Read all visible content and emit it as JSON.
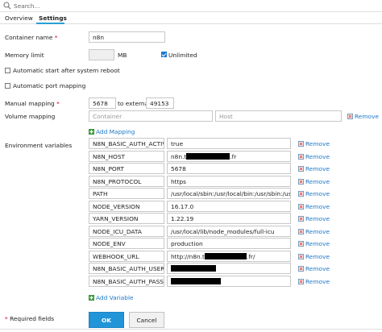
{
  "search": {
    "placeholder": "Search..."
  },
  "tabs": [
    {
      "label": "Overview"
    },
    {
      "label": "Settings"
    }
  ],
  "form": {
    "container_name": {
      "label": "Container name",
      "required_mark": "*",
      "value": "n8n"
    },
    "memory_limit": {
      "label": "Memory limit",
      "value": "",
      "unit": "MB",
      "unlimited_label": "Unlimited",
      "unlimited_checked": true
    },
    "auto_start": {
      "label": "Automatic start after system reboot",
      "checked": false
    },
    "auto_port": {
      "label": "Automatic port mapping",
      "checked": false
    },
    "manual_mapping": {
      "label": "Manual mapping",
      "required_mark": "*",
      "internal": "5678",
      "to_external_label": "to external",
      "external": "49153"
    },
    "volume_mapping": {
      "label": "Volume mapping",
      "container_placeholder": "Container",
      "host_placeholder": "Host",
      "remove_label": "Remove",
      "add_label": "Add Mapping"
    },
    "env": {
      "label": "Environment variables",
      "remove_label": "Remove",
      "add_label": "Add Variable",
      "rows": [
        {
          "name": "N8N_BASIC_AUTH_ACTIVE",
          "value": "true"
        },
        {
          "name": "N8N_HOST",
          "value_prefix": "n8n.t",
          "value_suffix": ".fr"
        },
        {
          "name": "N8N_PORT",
          "value": "5678"
        },
        {
          "name": "N8N_PROTOCOL",
          "value": "https"
        },
        {
          "name": "PATH",
          "value": "/usr/local/sbin:/usr/local/bin:/usr/sbin:/usr/bin"
        },
        {
          "name": "NODE_VERSION",
          "value": "16.17.0"
        },
        {
          "name": "YARN_VERSION",
          "value": "1.22.19"
        },
        {
          "name": "NODE_ICU_DATA",
          "value": "/usr/local/lib/node_modules/full-icu"
        },
        {
          "name": "NODE_ENV",
          "value": "production"
        },
        {
          "name": "WEBHOOK_URL",
          "value_prefix": "http://n8n.t",
          "value_suffix": ".fr/"
        },
        {
          "name": "N8N_BASIC_AUTH_USER",
          "value": ""
        },
        {
          "name": "N8N_BASIC_AUTH_PASSWO",
          "value": ""
        }
      ]
    },
    "required_note": {
      "mark": "*",
      "text": "Required fields"
    }
  },
  "buttons": {
    "ok": "OK",
    "cancel": "Cancel"
  },
  "colors": {
    "accent": "#2295d8",
    "link": "#1b78c8",
    "required": "#d0021b",
    "remove_icon": "#e0574a"
  }
}
